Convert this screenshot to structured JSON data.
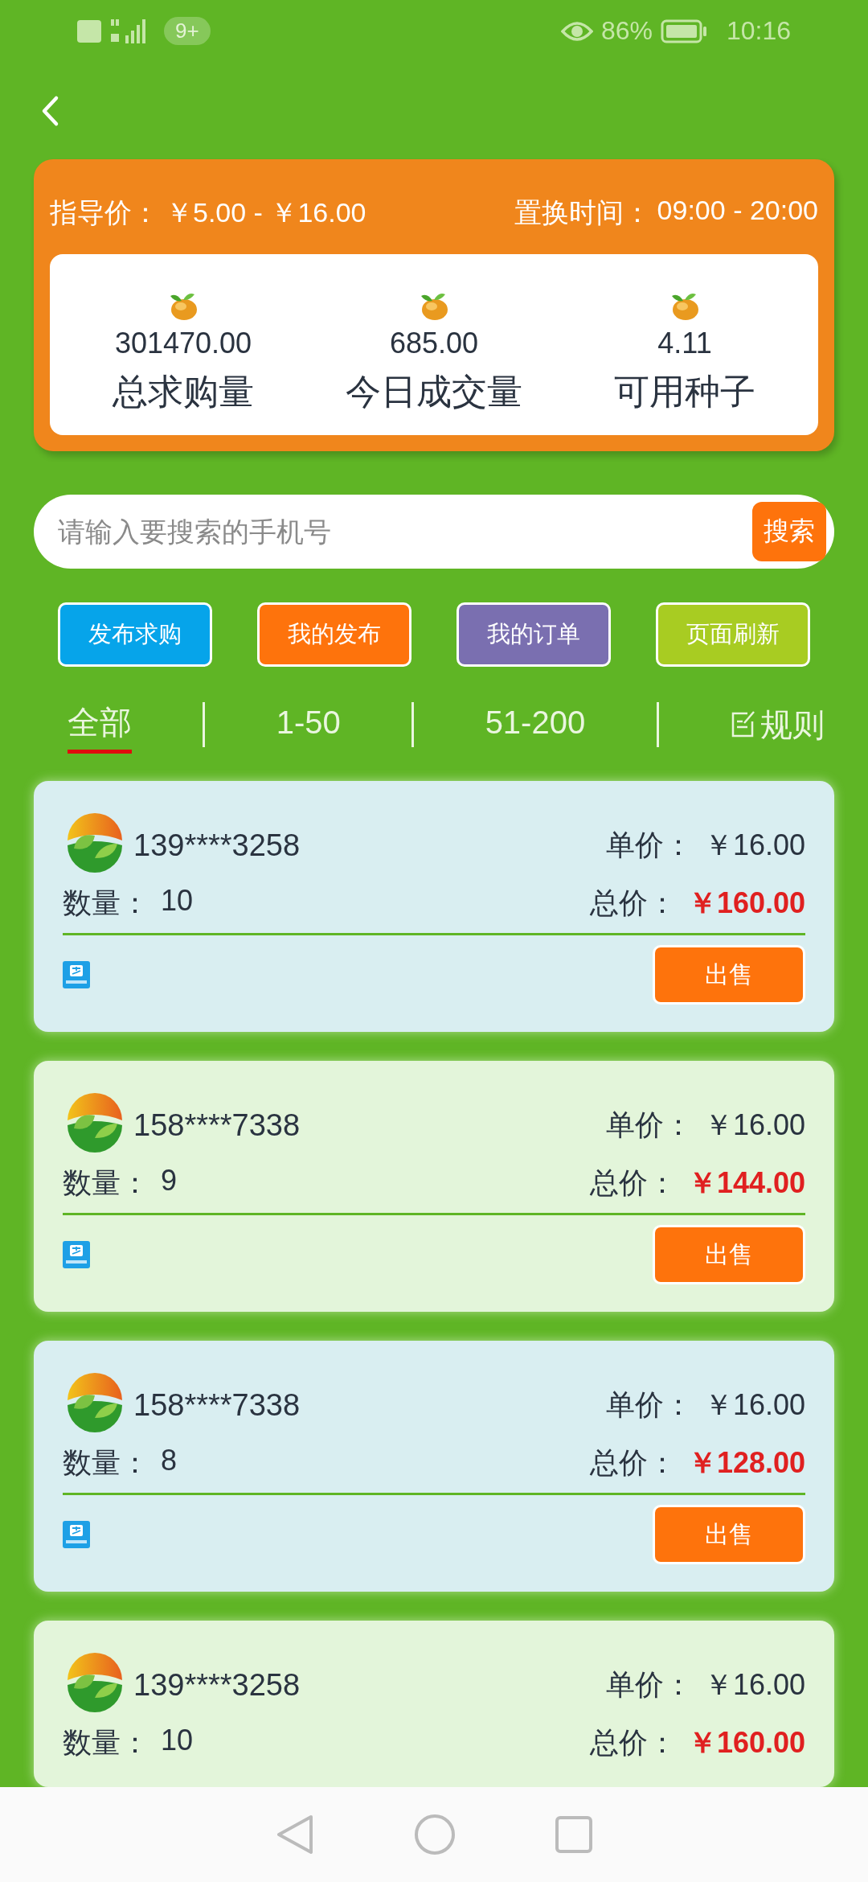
{
  "status_bar": {
    "badge": "9+",
    "battery": "86%",
    "time": "10:16"
  },
  "summary": {
    "guide_label": "指导价：",
    "guide_value": "￥5.00 - ￥16.00",
    "time_label": "置换时间：",
    "time_value": "09:00 - 20:00",
    "stats": [
      {
        "value": "301470.00",
        "label": "总求购量"
      },
      {
        "value": "685.00",
        "label": "今日成交量"
      },
      {
        "value": "4.11",
        "label": "可用种子"
      }
    ]
  },
  "search": {
    "placeholder": "请输入要搜索的手机号",
    "button": "搜索"
  },
  "actions": [
    {
      "label": "发布求购",
      "color": "#06a4ea"
    },
    {
      "label": "我的发布",
      "color": "#fe730c"
    },
    {
      "label": "我的订单",
      "color": "#7a6fb0"
    },
    {
      "label": "页面刷新",
      "color": "#a8cc22"
    }
  ],
  "tabs": [
    {
      "label": "全部",
      "selected": true
    },
    {
      "label": "1-50",
      "selected": false
    },
    {
      "label": "51-200",
      "selected": false
    }
  ],
  "rules_link": "规则",
  "orders": [
    {
      "color": "#d9eef1",
      "phone": "139****3258",
      "unit_label": "单价：",
      "unit_price": "￥16.00",
      "qty_label": "数量：",
      "qty": "10",
      "total_label": "总价：",
      "total": "￥160.00",
      "sell_button": "出售"
    },
    {
      "color": "#e3f5da",
      "phone": "158****7338",
      "unit_label": "单价：",
      "unit_price": "￥16.00",
      "qty_label": "数量：",
      "qty": "9",
      "total_label": "总价：",
      "total": "￥144.00",
      "sell_button": "出售"
    },
    {
      "color": "#d9eef1",
      "phone": "158****7338",
      "unit_label": "单价：",
      "unit_price": "￥16.00",
      "qty_label": "数量：",
      "qty": "8",
      "total_label": "总价：",
      "total": "￥128.00",
      "sell_button": "出售"
    },
    {
      "color": "#e3f5da",
      "phone": "139****3258",
      "unit_label": "单价：",
      "unit_price": "￥16.00",
      "qty_label": "数量：",
      "qty": "10",
      "total_label": "总价：",
      "total": "￥160.00"
    }
  ]
}
